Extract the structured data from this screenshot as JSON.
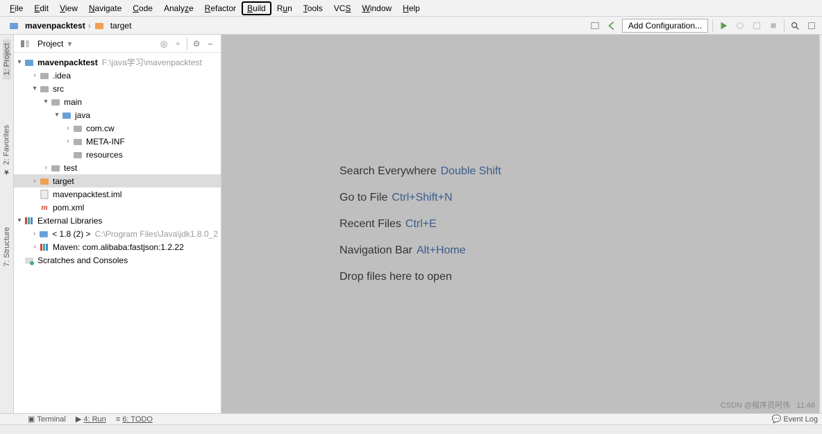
{
  "menu": [
    "File",
    "Edit",
    "View",
    "Navigate",
    "Code",
    "Analyze",
    "Refactor",
    "Build",
    "Run",
    "Tools",
    "VCS",
    "Window",
    "Help"
  ],
  "breadcrumb": {
    "project": "mavenpacktest",
    "sep": "›",
    "item": "target"
  },
  "toolbar": {
    "add_config": "Add Configuration..."
  },
  "project_panel": {
    "title": "Project"
  },
  "tree": {
    "root": {
      "name": "mavenpacktest",
      "path": "F:\\java学习\\mavenpacktest"
    },
    "idea": ".idea",
    "src": "src",
    "main": "main",
    "java": "java",
    "comcw": "com.cw",
    "metainf": "META-INF",
    "resources": "resources",
    "test": "test",
    "target": "target",
    "iml": "mavenpacktest.iml",
    "pom": "pom.xml",
    "ext": "External Libraries",
    "jdk": {
      "name": "< 1.8 (2) >",
      "path": "C:\\Program Files\\Java\\jdk1.8.0_2"
    },
    "maven": "Maven: com.alibaba:fastjson:1.2.22",
    "scratch": "Scratches and Consoles"
  },
  "hints": {
    "search": {
      "t": "Search Everywhere",
      "k": "Double Shift"
    },
    "goto": {
      "t": "Go to File",
      "k": "Ctrl+Shift+N"
    },
    "recent": {
      "t": "Recent Files",
      "k": "Ctrl+E"
    },
    "navbar": {
      "t": "Navigation Bar",
      "k": "Alt+Home"
    },
    "drop": {
      "t": "Drop files here to open"
    }
  },
  "left_tabs": {
    "project": "1: Project",
    "favorites": "2: Favorites",
    "structure": "7: Structure"
  },
  "bottom": {
    "terminal": "Terminal",
    "run": "4: Run",
    "todo": "6: TODO",
    "eventlog": "Event Log"
  },
  "watermark": "CSDN @程序员阿伟",
  "clock": "11:46"
}
